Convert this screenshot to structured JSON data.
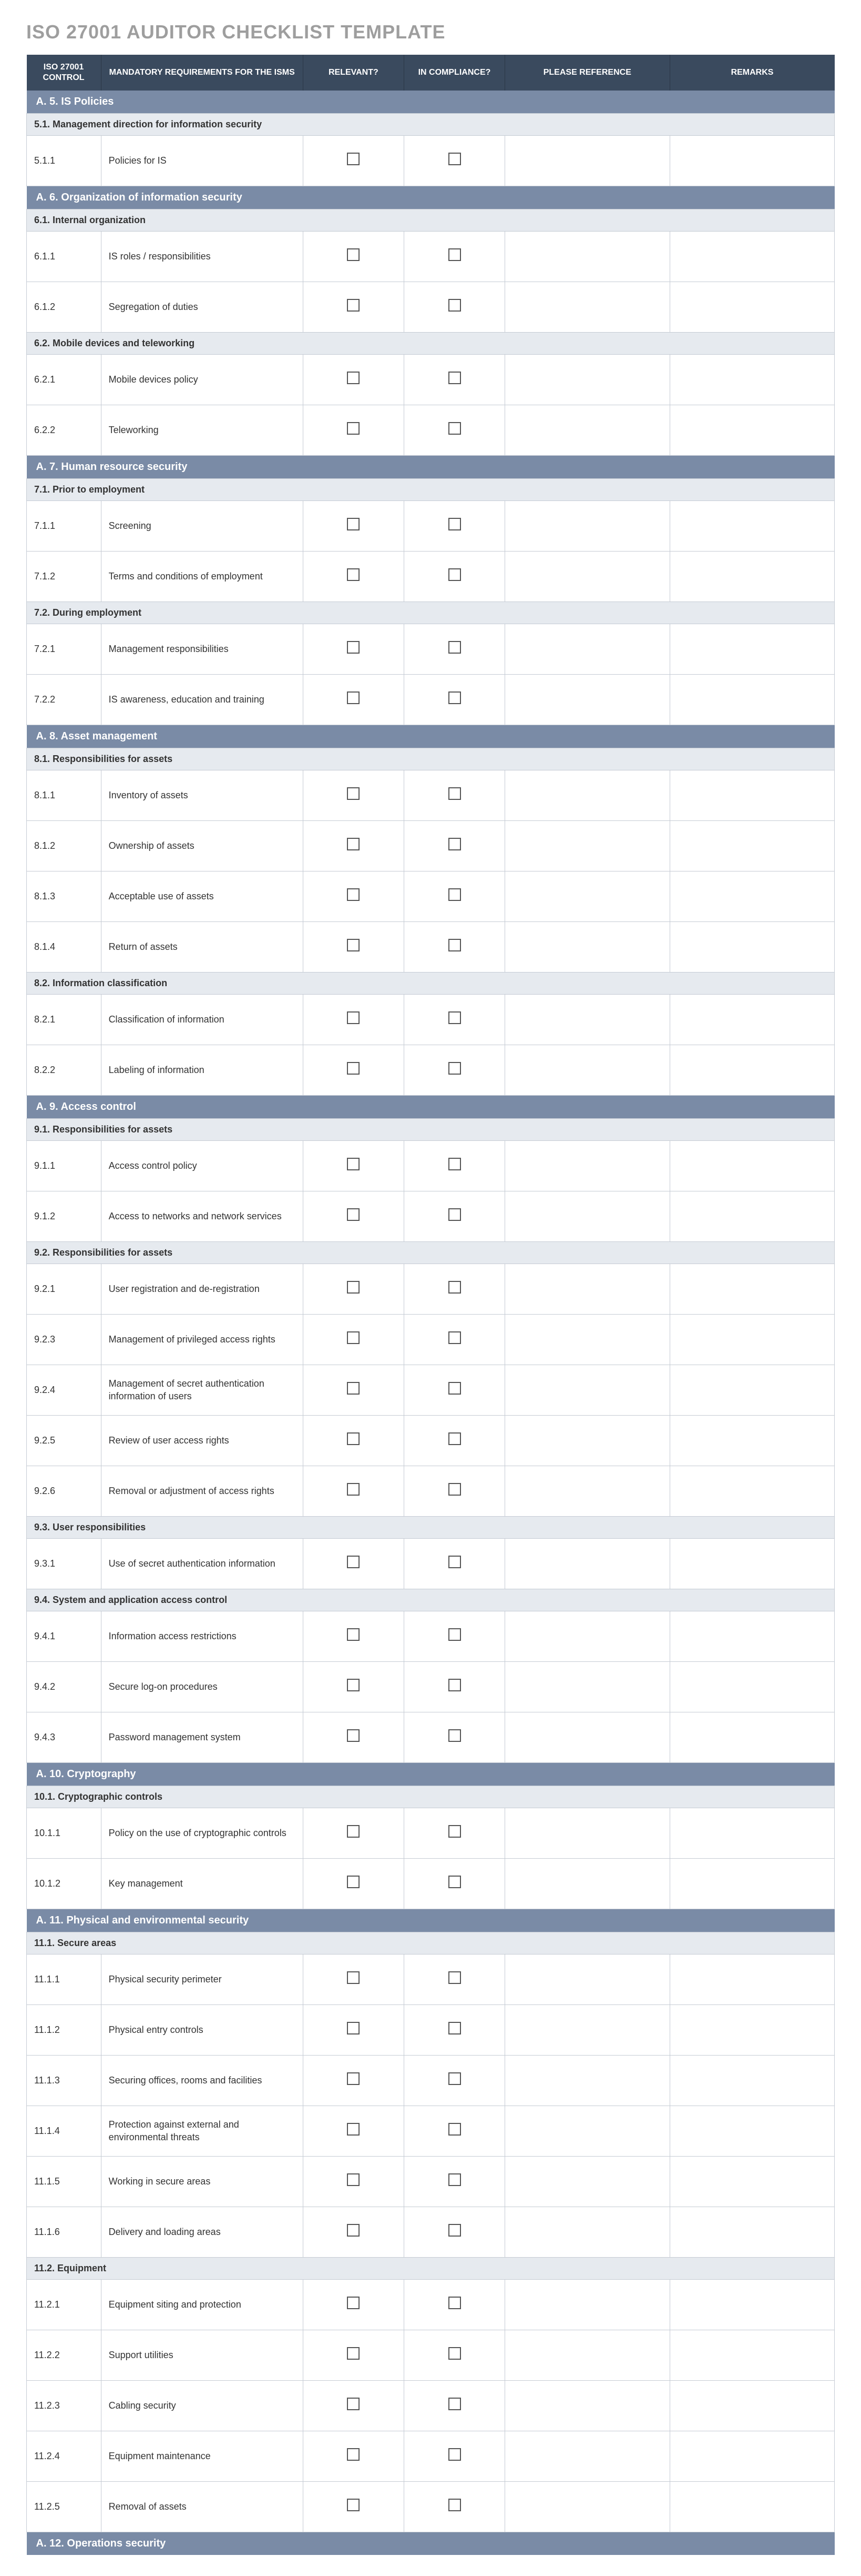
{
  "title": "ISO 27001 AUDITOR CHECKLIST TEMPLATE",
  "headers": {
    "control": "ISO 27001 CONTROL",
    "mandatory": "MANDATORY REQUIREMENTS FOR THE ISMS",
    "relevant": "RELEVANT?",
    "compliance": "IN COMPLIANCE?",
    "reference": "PLEASE REFERENCE",
    "remarks": "REMARKS"
  },
  "sections": [
    {
      "title": "A. 5. IS Policies",
      "subsections": [
        {
          "title": "5.1. Management direction for information security",
          "items": [
            {
              "control": "5.1.1",
              "req": "Policies for IS"
            }
          ]
        }
      ]
    },
    {
      "title": "A. 6. Organization of information security",
      "subsections": [
        {
          "title": "6.1. Internal organization",
          "items": [
            {
              "control": "6.1.1",
              "req": "IS roles / responsibilities"
            },
            {
              "control": "6.1.2",
              "req": "Segregation of duties"
            }
          ]
        },
        {
          "title": "6.2. Mobile devices and teleworking",
          "items": [
            {
              "control": "6.2.1",
              "req": "Mobile devices policy"
            },
            {
              "control": "6.2.2",
              "req": "Teleworking"
            }
          ]
        }
      ]
    },
    {
      "title": "A. 7. Human resource security",
      "subsections": [
        {
          "title": "7.1. Prior to employment",
          "items": [
            {
              "control": "7.1.1",
              "req": "Screening"
            },
            {
              "control": "7.1.2",
              "req": "Terms and conditions of employment"
            }
          ]
        },
        {
          "title": "7.2. During employment",
          "items": [
            {
              "control": "7.2.1",
              "req": "Management responsibilities"
            },
            {
              "control": "7.2.2",
              "req": "IS awareness, education and training"
            }
          ]
        }
      ]
    },
    {
      "title": "A. 8. Asset management",
      "subsections": [
        {
          "title": "8.1. Responsibilities for assets",
          "items": [
            {
              "control": "8.1.1",
              "req": "Inventory of assets"
            },
            {
              "control": "8.1.2",
              "req": "Ownership of assets"
            },
            {
              "control": "8.1.3",
              "req": "Acceptable use of assets"
            },
            {
              "control": "8.1.4",
              "req": "Return of assets"
            }
          ]
        },
        {
          "title": "8.2. Information classification",
          "items": [
            {
              "control": "8.2.1",
              "req": "Classification of information"
            },
            {
              "control": "8.2.2",
              "req": "Labeling of information"
            }
          ]
        }
      ]
    },
    {
      "title": "A. 9. Access control",
      "subsections": [
        {
          "title": "9.1. Responsibilities for assets",
          "items": [
            {
              "control": "9.1.1",
              "req": "Access control policy"
            },
            {
              "control": "9.1.2",
              "req": "Access to networks and network services"
            }
          ]
        },
        {
          "title": "9.2. Responsibilities for assets",
          "items": [
            {
              "control": "9.2.1",
              "req": "User registration and de-registration"
            },
            {
              "control": "9.2.3",
              "req": "Management of privileged access rights"
            },
            {
              "control": "9.2.4",
              "req": "Management of secret authentication information of users"
            },
            {
              "control": "9.2.5",
              "req": "Review of user access rights"
            },
            {
              "control": "9.2.6",
              "req": "Removal or adjustment of access rights"
            }
          ]
        },
        {
          "title": "9.3. User responsibilities",
          "items": [
            {
              "control": "9.3.1",
              "req": "Use of secret authentication information"
            }
          ]
        },
        {
          "title": "9.4. System and application access control",
          "items": [
            {
              "control": "9.4.1",
              "req": "Information access restrictions"
            },
            {
              "control": "9.4.2",
              "req": "Secure log-on procedures"
            },
            {
              "control": "9.4.3",
              "req": "Password management system"
            }
          ]
        }
      ]
    },
    {
      "title": "A. 10. Cryptography",
      "subsections": [
        {
          "title": "10.1. Cryptographic controls",
          "items": [
            {
              "control": "10.1.1",
              "req": "Policy on the use of cryptographic controls"
            },
            {
              "control": "10.1.2",
              "req": "Key management"
            }
          ]
        }
      ]
    },
    {
      "title": "A. 11. Physical and environmental security",
      "subsections": [
        {
          "title": "11.1. Secure areas",
          "items": [
            {
              "control": "11.1.1",
              "req": "Physical security perimeter"
            },
            {
              "control": "11.1.2",
              "req": "Physical entry controls"
            },
            {
              "control": "11.1.3",
              "req": "Securing offices, rooms and facilities"
            },
            {
              "control": "11.1.4",
              "req": "Protection against external and environmental threats"
            },
            {
              "control": "11.1.5",
              "req": "Working in secure areas"
            },
            {
              "control": "11.1.6",
              "req": "Delivery and loading areas"
            }
          ]
        },
        {
          "title": "11.2. Equipment",
          "items": [
            {
              "control": "11.2.1",
              "req": "Equipment siting and protection"
            },
            {
              "control": "11.2.2",
              "req": "Support utilities"
            },
            {
              "control": "11.2.3",
              "req": "Cabling security"
            },
            {
              "control": "11.2.4",
              "req": "Equipment maintenance"
            },
            {
              "control": "11.2.5",
              "req": "Removal of assets"
            }
          ]
        }
      ]
    },
    {
      "title": "A. 12. Operations security",
      "subsections": []
    }
  ]
}
